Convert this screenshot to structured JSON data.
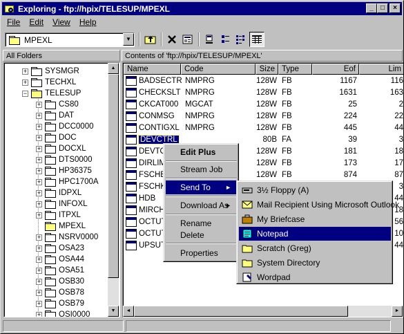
{
  "window": {
    "title": "Exploring - ftp://hpix/TELESUP/MPEXL",
    "min": "_",
    "max": "□",
    "close": "×"
  },
  "menu": [
    "File",
    "Edit",
    "View",
    "Help"
  ],
  "address": {
    "value": "MPEXL"
  },
  "left_header": "All Folders",
  "right_header": "Contents of 'ftp://hpix/TELESUP/MPEXL'",
  "tree": [
    {
      "label": "SYSMGR",
      "box": "plus",
      "indent": 0
    },
    {
      "label": "TECHXL",
      "box": "plus",
      "indent": 0
    },
    {
      "label": "TELESUP",
      "box": "minus",
      "indent": 0
    },
    {
      "label": "CS80",
      "box": "plus",
      "indent": 1
    },
    {
      "label": "DAT",
      "box": "plus",
      "indent": 1
    },
    {
      "label": "DCC0000",
      "box": "plus",
      "indent": 1
    },
    {
      "label": "DOC",
      "box": "plus",
      "indent": 1
    },
    {
      "label": "DOCXL",
      "box": "plus",
      "indent": 1
    },
    {
      "label": "DTS0000",
      "box": "plus",
      "indent": 1
    },
    {
      "label": "HP36375",
      "box": "plus",
      "indent": 1
    },
    {
      "label": "HPC1700A",
      "box": "plus",
      "indent": 1
    },
    {
      "label": "IDPXL",
      "box": "plus",
      "indent": 1
    },
    {
      "label": "INFOXL",
      "box": "plus",
      "indent": 1
    },
    {
      "label": "ITPXL",
      "box": "plus",
      "indent": 1
    },
    {
      "label": "MPEXL",
      "box": "none",
      "indent": 1
    },
    {
      "label": "NSRV0000",
      "box": "plus",
      "indent": 1
    },
    {
      "label": "OSA23",
      "box": "plus",
      "indent": 1
    },
    {
      "label": "OSA44",
      "box": "plus",
      "indent": 1
    },
    {
      "label": "OSA51",
      "box": "plus",
      "indent": 1
    },
    {
      "label": "OSB30",
      "box": "plus",
      "indent": 1
    },
    {
      "label": "OSB78",
      "box": "plus",
      "indent": 1
    },
    {
      "label": "OSB79",
      "box": "plus",
      "indent": 1
    },
    {
      "label": "OSI0000",
      "box": "plus",
      "indent": 1
    }
  ],
  "columns": [
    "Name",
    "Code",
    "Size",
    "Type",
    "Eof",
    "Lim"
  ],
  "files": [
    {
      "name": "BADSECTR",
      "code": "NMPRG",
      "size": "128W",
      "type": "FB",
      "eof": "1167",
      "lim": "116"
    },
    {
      "name": "CHECKSLT",
      "code": "NMPRG",
      "size": "128W",
      "type": "FB",
      "eof": "1631",
      "lim": "163"
    },
    {
      "name": "CKCAT000",
      "code": "MGCAT",
      "size": "128W",
      "type": "FB",
      "eof": "25",
      "lim": "2"
    },
    {
      "name": "CONMSG",
      "code": "NMPRG",
      "size": "128W",
      "type": "FB",
      "eof": "224",
      "lim": "22"
    },
    {
      "name": "CONTIGXL",
      "code": "NMPRG",
      "size": "128W",
      "type": "FB",
      "eof": "445",
      "lim": "44"
    },
    {
      "name": "DEVCTRL",
      "code": "",
      "size": "80B",
      "type": "FA",
      "eof": "39",
      "lim": "3"
    },
    {
      "name": "DEVTO",
      "code": "",
      "size": "128W",
      "type": "FB",
      "eof": "181",
      "lim": "18"
    },
    {
      "name": "DIRLIM",
      "code": "",
      "size": "128W",
      "type": "FB",
      "eof": "173",
      "lim": "17"
    },
    {
      "name": "FSCHEC",
      "code": "",
      "size": "128W",
      "type": "FB",
      "eof": "874",
      "lim": "87"
    },
    {
      "name": "FSCHKC",
      "code": "",
      "size": "",
      "type": "",
      "eof": "",
      "lim": "3"
    },
    {
      "name": "HDB",
      "code": "",
      "size": "",
      "type": "",
      "eof": "",
      "lim": "44"
    },
    {
      "name": "MIRCHE",
      "code": "",
      "size": "",
      "type": "",
      "eof": "",
      "lim": "18"
    },
    {
      "name": "OCTUT",
      "code": "",
      "size": "",
      "type": "",
      "eof": "",
      "lim": "56"
    },
    {
      "name": "OCTUT",
      "code": "",
      "size": "",
      "type": "",
      "eof": "",
      "lim": "10"
    },
    {
      "name": "UPSUT",
      "code": "",
      "size": "",
      "type": "",
      "eof": "",
      "lim": "44"
    }
  ],
  "context_menu": {
    "edit_plus": "Edit Plus",
    "stream_job": "Stream Job",
    "send_to": "Send To",
    "download_as": "Download As",
    "rename": "Rename",
    "delete": "Delete",
    "properties": "Properties"
  },
  "send_to_menu": [
    {
      "label": "3½ Floppy (A)",
      "icon": "floppy-icon"
    },
    {
      "label": "Mail Recipient Using Microsoft Outlook",
      "icon": "mail-icon"
    },
    {
      "label": "My Briefcase",
      "icon": "briefcase-icon"
    },
    {
      "label": "Notepad",
      "icon": "notepad-icon"
    },
    {
      "label": "Scratch (Greg)",
      "icon": "folder-icon"
    },
    {
      "label": "System Directory",
      "icon": "folder-icon"
    },
    {
      "label": "Wordpad",
      "icon": "wordpad-icon"
    }
  ],
  "colors": {
    "title_bar": "#000080",
    "selection": "#000080",
    "face": "#c0c0c0"
  }
}
